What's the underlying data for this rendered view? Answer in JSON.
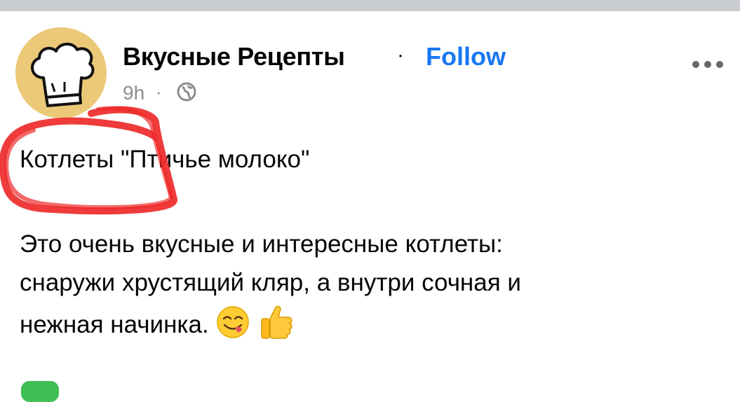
{
  "post": {
    "author": "Вкусные Рецепты",
    "separator": "·",
    "follow_label": "Follow",
    "timestamp": "9h",
    "meta_separator": "·",
    "audience_icon": "globe-icon",
    "more_icon": "more-horizontal-icon",
    "avatar_icon": "chef-hat-icon",
    "title": "Котлеты \"Птичье молоко\"",
    "body_lines": [
      "Это очень вкусные и интересные котлеты:",
      "снаружи хрустящий кляр, а внутри сочная и",
      "нежная начинка."
    ],
    "emojis": [
      "face-savoring-food-emoji",
      "thumbs-up-emoji"
    ]
  },
  "colors": {
    "follow": "#1877f2",
    "text": "#050505",
    "meta": "#8a8d91",
    "avatar_bg": "#ecc978",
    "scribble": "#ee2a2a",
    "divider": "#c9ccd1",
    "reaction": "#3fbf55"
  }
}
